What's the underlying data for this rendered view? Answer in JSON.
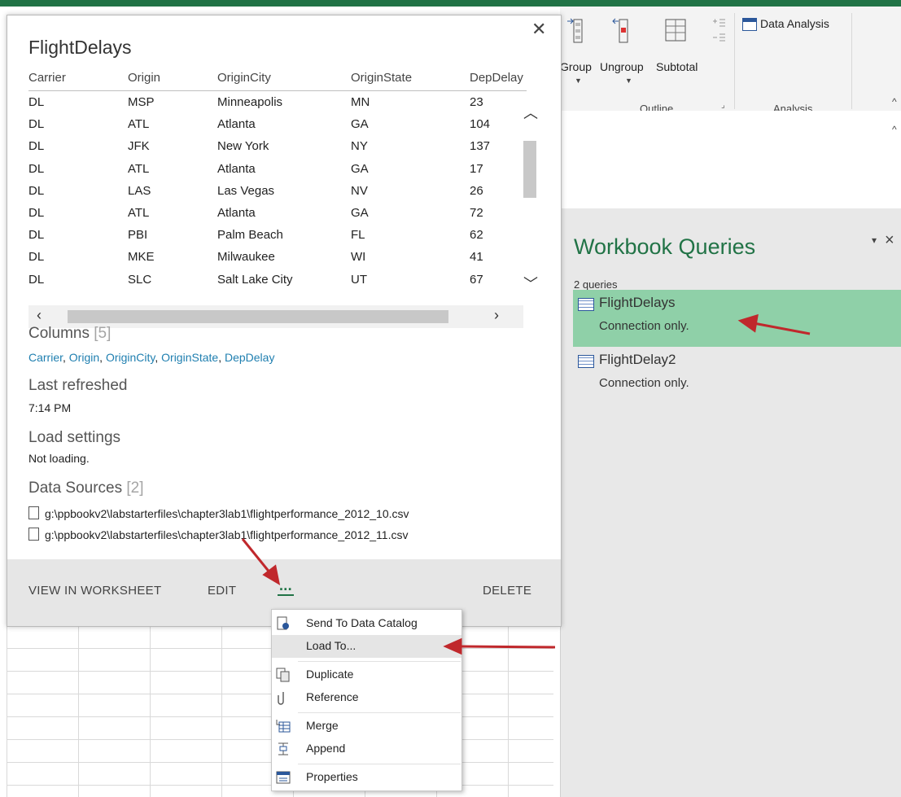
{
  "ribbon": {
    "group_label": "Group",
    "ungroup_label": "Ungroup",
    "subtotal_label": "Subtotal",
    "outline_group": "Outline",
    "data_analysis_label": "Data Analysis",
    "analysis_group": "Analysis"
  },
  "workbook_queries": {
    "title": "Workbook Queries",
    "count_label": "2 queries",
    "items": [
      {
        "name": "FlightDelays",
        "status": "Connection only."
      },
      {
        "name": "FlightDelay2",
        "status": "Connection only."
      }
    ],
    "selected_color": "#8fd0a8",
    "accent_color": "#217346"
  },
  "card": {
    "title": "FlightDelays",
    "close_icon": "close-icon",
    "columns_header": [
      "Carrier",
      "Origin",
      "OriginCity",
      "OriginState",
      "DepDelay"
    ],
    "rows": [
      [
        "DL",
        "MSP",
        "Minneapolis",
        "MN",
        "23"
      ],
      [
        "DL",
        "ATL",
        "Atlanta",
        "GA",
        "104"
      ],
      [
        "DL",
        "JFK",
        "New York",
        "NY",
        "137"
      ],
      [
        "DL",
        "ATL",
        "Atlanta",
        "GA",
        "17"
      ],
      [
        "DL",
        "LAS",
        "Las Vegas",
        "NV",
        "26"
      ],
      [
        "DL",
        "ATL",
        "Atlanta",
        "GA",
        "72"
      ],
      [
        "DL",
        "PBI",
        "Palm Beach",
        "FL",
        "62"
      ],
      [
        "DL",
        "MKE",
        "Milwaukee",
        "WI",
        "41"
      ],
      [
        "DL",
        "SLC",
        "Salt Lake City",
        "UT",
        "67"
      ]
    ],
    "columns_label": "Columns",
    "columns_count": "[5]",
    "columns_links": [
      "Carrier",
      "Origin",
      "OriginCity",
      "OriginState",
      "DepDelay"
    ],
    "last_refreshed_label": "Last refreshed",
    "last_refreshed_value": "7:14 PM",
    "load_settings_label": "Load settings",
    "load_settings_value": "Not loading.",
    "data_sources_label": "Data Sources",
    "data_sources_count": "[2]",
    "data_sources": [
      "g:\\ppbookv2\\labstarterfiles\\chapter3lab1\\flightperformance_2012_10.csv",
      "g:\\ppbookv2\\labstarterfiles\\chapter3lab1\\flightperformance_2012_11.csv"
    ],
    "footer": {
      "view_in_worksheet": "VIEW IN WORKSHEET",
      "edit": "EDIT",
      "more": "...",
      "delete": "DELETE"
    }
  },
  "context_menu": {
    "items": [
      {
        "label": "Send To Data Catalog",
        "icon": "catalog-icon"
      },
      {
        "label": "Load To...",
        "icon": ""
      },
      {
        "label": "Duplicate",
        "icon": "duplicate-icon"
      },
      {
        "label": "Reference",
        "icon": "reference-icon"
      },
      {
        "label": "Merge",
        "icon": "merge-icon"
      },
      {
        "label": "Append",
        "icon": "append-icon"
      },
      {
        "label": "Properties",
        "icon": "properties-icon"
      }
    ]
  },
  "annotation_color": "#c0282c"
}
